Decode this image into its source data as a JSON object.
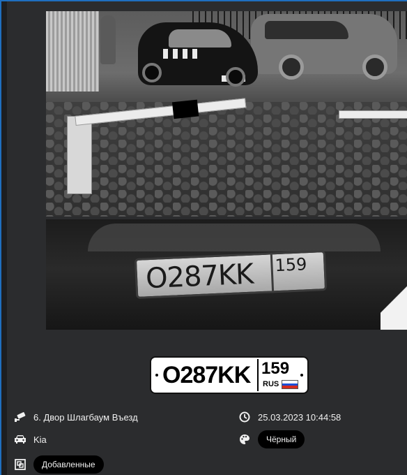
{
  "plate": {
    "number": "O287KK",
    "region": "159",
    "country": "RUS",
    "flag_colors": [
      "#ffffff",
      "#1c4fd8",
      "#d52b1e"
    ]
  },
  "crop_plate": {
    "number": "O287KK",
    "region": "159"
  },
  "event": {
    "camera_icon": "cctv-camera-icon",
    "camera_name": "6. Двор Шлагбаум Въезд",
    "time_icon": "clock-icon",
    "datetime": "25.03.2023 10:44:58",
    "car_icon": "car-icon",
    "make": "Kia",
    "color_icon": "palette-icon",
    "color": "Чёрный",
    "list_icon": "list-icon",
    "list": "Добавленные"
  },
  "colors": {
    "panel_bg": "#2b2c2e",
    "accent": "#1f6fbf",
    "pill_bg": "#000000",
    "text": "#f0f0f0"
  }
}
